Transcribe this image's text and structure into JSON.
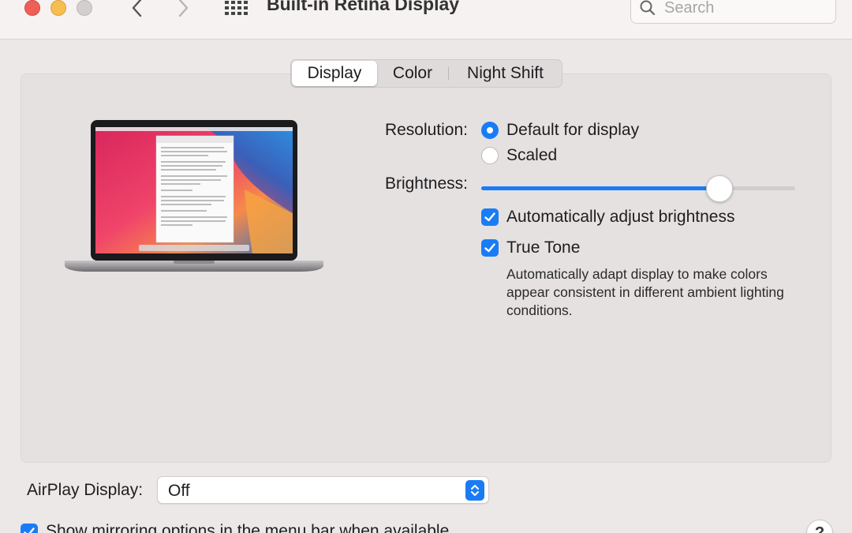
{
  "window": {
    "title": "Built-in Retina Display"
  },
  "search": {
    "placeholder": "Search"
  },
  "tabs": [
    {
      "label": "Display",
      "selected": true
    },
    {
      "label": "Color",
      "selected": false
    },
    {
      "label": "Night Shift",
      "selected": false
    }
  ],
  "resolution": {
    "label": "Resolution:",
    "options": [
      {
        "label": "Default for display",
        "selected": true
      },
      {
        "label": "Scaled",
        "selected": false
      }
    ]
  },
  "brightness": {
    "label": "Brightness:",
    "value_fraction": 0.76
  },
  "auto_brightness": {
    "label": "Automatically adjust brightness",
    "checked": true
  },
  "true_tone": {
    "label": "True Tone",
    "checked": true,
    "description": "Automatically adapt display to make colors appear consistent in different ambient lighting conditions."
  },
  "airplay": {
    "label": "AirPlay Display:",
    "value": "Off"
  },
  "mirroring": {
    "label": "Show mirroring options in the menu bar when available",
    "checked": true
  },
  "help": {
    "label": "?"
  },
  "colors": {
    "accent": "#1a7cf5",
    "close": "#ee5f57",
    "minimize": "#f6be4f"
  },
  "icons": [
    "close-icon",
    "minimize-icon",
    "zoom-icon",
    "back-chevron-icon",
    "forward-chevron-icon",
    "show-all-grid-icon",
    "search-icon",
    "macbook-image",
    "checkmark-icon",
    "up-down-arrows-icon"
  ]
}
